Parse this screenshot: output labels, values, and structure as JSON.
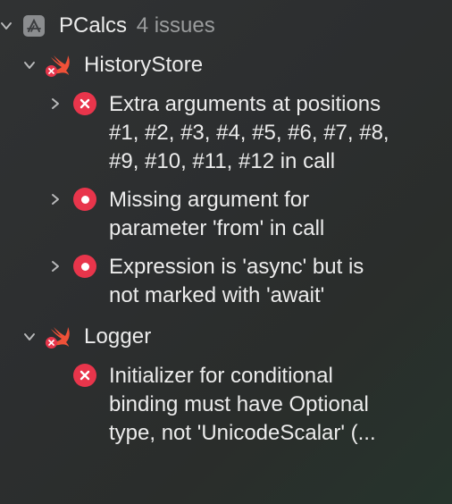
{
  "project": {
    "name": "PCalcs",
    "issue_count": "4 issues",
    "icon": "app-project-icon"
  },
  "files": [
    {
      "name": "HistoryStore",
      "icon": "swift-file-icon",
      "issues": [
        {
          "kind": "error",
          "icon": "error-x-icon",
          "lines": [
            "Extra arguments at positions",
            "#1, #2, #3, #4, #5, #6, #7, #8,",
            "#9, #10, #11, #12 in call"
          ]
        },
        {
          "kind": "error-fixable",
          "icon": "error-dot-icon",
          "lines": [
            "Missing argument for",
            "parameter 'from' in call"
          ]
        },
        {
          "kind": "error-fixable",
          "icon": "error-dot-icon",
          "lines": [
            "Expression is 'async' but is",
            "not marked with 'await'"
          ]
        }
      ]
    },
    {
      "name": "Logger",
      "icon": "swift-file-icon",
      "issues": [
        {
          "kind": "error",
          "icon": "error-x-icon",
          "lines": [
            "Initializer for conditional",
            "binding must have Optional",
            "type, not 'UnicodeScalar' (..."
          ]
        }
      ]
    }
  ],
  "colors": {
    "error": "#e8354b",
    "text": "#ececec",
    "muted": "#9a9c9d",
    "swift": "#f05138"
  }
}
